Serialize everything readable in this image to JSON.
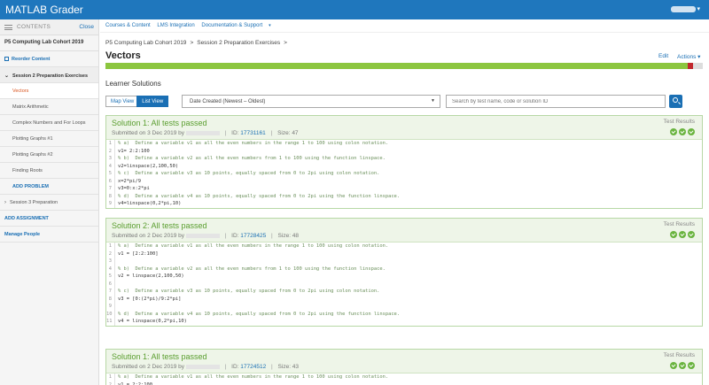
{
  "app": {
    "title": "MATLAB Grader",
    "user_caret": "▾"
  },
  "sidebar": {
    "contents_label": "CONTENTS",
    "close_label": "Close",
    "course": "P5 Computing Lab Cohort 2019",
    "reorder": "Reorder Content",
    "section": "Session 2 Preparation Exercises",
    "items": [
      {
        "label": "Vectors",
        "active": true
      },
      {
        "label": "Matrix Arithmetic"
      },
      {
        "label": "Complex Numbers and For Loops"
      },
      {
        "label": "Plotting Graphs #1"
      },
      {
        "label": "Plotting Graphs #2"
      },
      {
        "label": "Finding Roots"
      }
    ],
    "add_problem": "ADD PROBLEM",
    "session3": "Session 3 Preparation",
    "add_assignment": "ADD ASSIGNMENT",
    "manage_people": "Manage People"
  },
  "subnav": {
    "items": [
      "Courses & Content",
      "LMS Integration",
      "Documentation & Support"
    ]
  },
  "breadcrumb": {
    "course": "P5 Computing Lab Cohort 2019",
    "section": "Session 2 Preparation Exercises",
    "sep": ">"
  },
  "page": {
    "title": "Vectors",
    "edit": "Edit",
    "actions": "Actions",
    "progress_fraction": 0.975
  },
  "learner": {
    "title": "Learner Solutions",
    "map_view": "Map View",
    "list_view": "List View",
    "sort_value": "Date Created (Newest – Oldest)",
    "search_placeholder": "Search by test name, code or solution ID"
  },
  "solutions": [
    {
      "title": "Solution 1: All tests passed",
      "submitted": "Submitted on 3 Dec 2019 by",
      "id_label": "ID:",
      "id": "17731161",
      "size": "Size: 47",
      "test_results": "Test Results",
      "lines": [
        {
          "n": "1",
          "t": "% a)  Define a variable v1 as all the even numbers in the range 1 to 100 using colon notation.",
          "c": true
        },
        {
          "n": "2",
          "t": "v1= 2:2:100"
        },
        {
          "n": "3",
          "t": "% b)  Define a variable v2 as all the even numbers from 1 to 100 using the function linspace.",
          "c": true
        },
        {
          "n": "4",
          "t": "v2=linspace(2,100,50)"
        },
        {
          "n": "5",
          "t": "% c)  Define a variable v3 as 10 points, equally spaced from 0 to 2pi using colon notation.",
          "c": true
        },
        {
          "n": "6",
          "t": "x=2*pi/9"
        },
        {
          "n": "7",
          "t": "v3=0:x:2*pi"
        },
        {
          "n": "8",
          "t": "% d)  Define a variable v4 as 10 points, equally spaced from 0 to 2pi using the function linspace.",
          "c": true
        },
        {
          "n": "9",
          "t": "v4=linspace(0,2*pi,10)"
        }
      ]
    },
    {
      "title": "Solution 2: All tests passed",
      "submitted": "Submitted on 2 Dec 2019 by",
      "id_label": "ID:",
      "id": "17728425",
      "size": "Size: 48",
      "test_results": "Test Results",
      "lines": [
        {
          "n": "1",
          "t": "% a)  Define a variable v1 as all the even numbers in the range 1 to 100 using colon notation.",
          "c": true
        },
        {
          "n": "2",
          "t": "v1 = [2:2:100]"
        },
        {
          "n": "3",
          "t": ""
        },
        {
          "n": "4",
          "t": "% b)  Define a variable v2 as all the even numbers from 1 to 100 using the function linspace.",
          "c": true
        },
        {
          "n": "5",
          "t": "v2 = linspace(2,100,50)"
        },
        {
          "n": "6",
          "t": ""
        },
        {
          "n": "7",
          "t": "% c)  Define a variable v3 as 10 points, equally spaced from 0 to 2pi using colon notation.",
          "c": true
        },
        {
          "n": "8",
          "t": "v3 = [0:(2*pi)/9:2*pi]"
        },
        {
          "n": "9",
          "t": ""
        },
        {
          "n": "10",
          "t": "% d)  Define a variable v4 as 10 points, equally spaced from 0 to 2pi using the function linspace.",
          "c": true
        },
        {
          "n": "11",
          "t": "v4 = linspace(0,2*pi,10)"
        }
      ]
    },
    {
      "title": "Solution 1: All tests passed",
      "submitted": "Submitted on 2 Dec 2019 by",
      "id_label": "ID:",
      "id": "17724512",
      "size": "Size: 43",
      "test_results": "Test Results",
      "lines": [
        {
          "n": "1",
          "t": "% a)  Define a variable v1 as all the even numbers in the range 1 to 100 using colon notation.",
          "c": true
        },
        {
          "n": "2",
          "t": "v1 = 2:2:100"
        }
      ]
    }
  ]
}
